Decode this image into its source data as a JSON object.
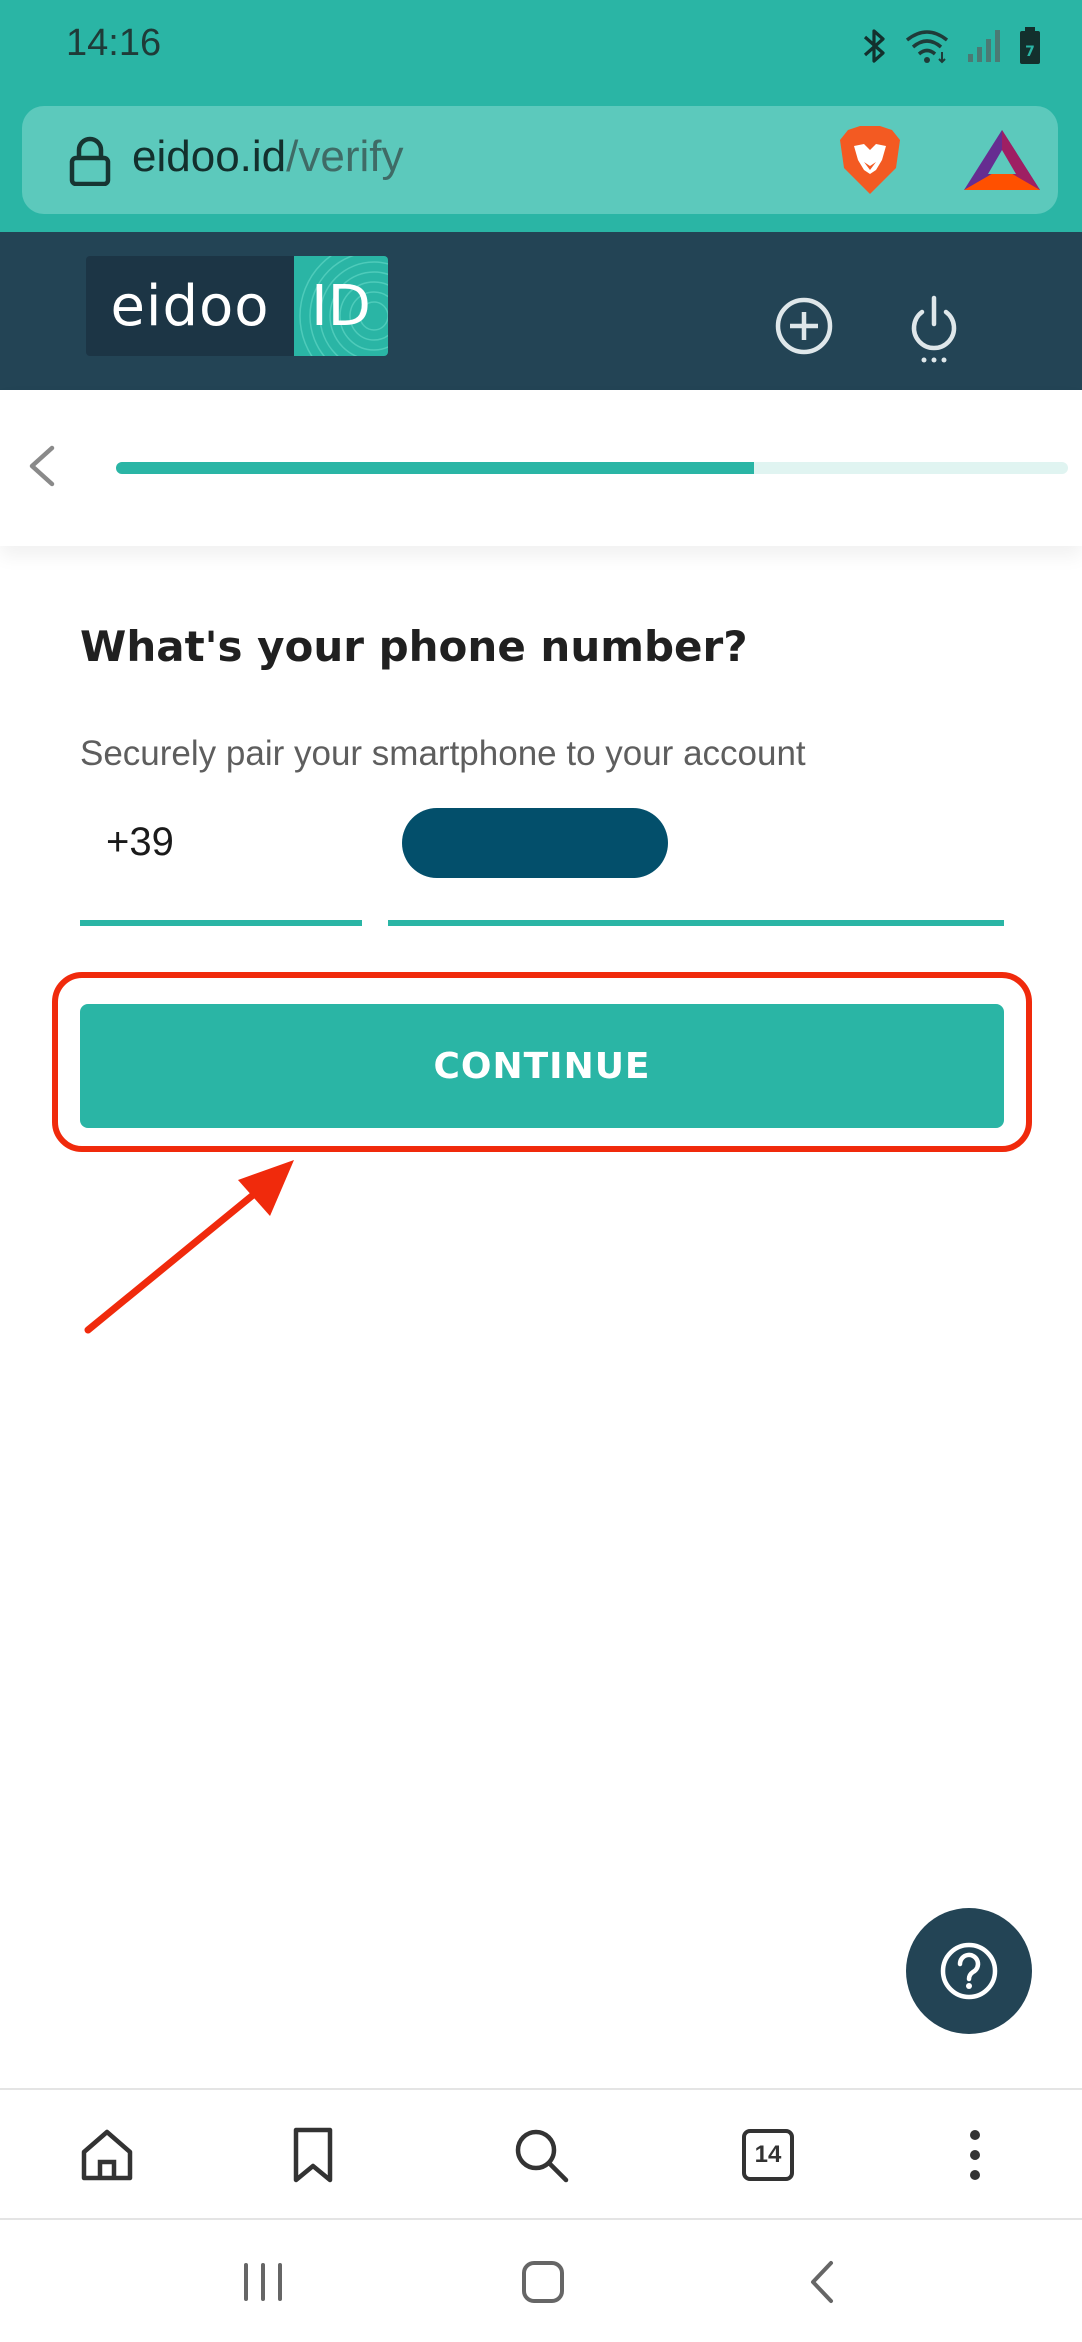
{
  "status_bar": {
    "time": "14:16",
    "icons": [
      "bluetooth-icon",
      "wifi-icon",
      "signal-icon",
      "battery-icon"
    ],
    "battery_level": "7"
  },
  "browser": {
    "url_domain": "eidoo.id",
    "url_path": "/verify",
    "icons": [
      "lock-icon",
      "brave-lion-icon",
      "bat-rewards-icon"
    ]
  },
  "site_header": {
    "logo_word": "eidoo",
    "logo_badge": "ID",
    "icons": [
      "plus-circle-icon",
      "power-icon"
    ]
  },
  "progress": {
    "fraction": 0.67,
    "back_icon": "chevron-left-icon"
  },
  "form": {
    "title": "What's your phone number?",
    "subtitle": "Securely pair your smartphone to your account",
    "country_code": "+39",
    "continue_label": "CONTINUE"
  },
  "help": {
    "icon": "question-circle-icon"
  },
  "toolbar": {
    "icons": [
      "home-icon",
      "bookmark-icon",
      "search-icon",
      "tabs-icon",
      "more-vertical-icon"
    ],
    "tab_count": "14"
  },
  "nav": {
    "icons": [
      "recent-apps-icon",
      "home-button-icon",
      "back-icon"
    ]
  },
  "colors": {
    "primary": "#2ab5a5",
    "header_dark": "#234455",
    "annotation_red": "#f02a0c",
    "redaction": "#034f6b"
  }
}
